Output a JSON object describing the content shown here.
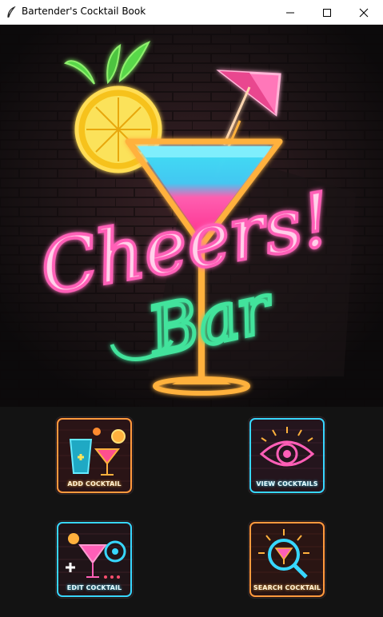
{
  "window": {
    "title": "Bartender's Cocktail Book",
    "app_icon": "feather-icon",
    "controls": {
      "minimize": "minimize-icon",
      "maximize": "maximize-icon",
      "close": "close-icon"
    }
  },
  "hero": {
    "neon_text": "Cheers!",
    "neon_script": "Bar",
    "icon": "neon-cocktail-sign"
  },
  "menu": {
    "add": {
      "label": "ADD COCKTAIL",
      "icon": "cocktail-glasses-icon"
    },
    "view": {
      "label": "VIEW COCKTAILS",
      "icon": "eye-icon"
    },
    "edit": {
      "label": "EDIT COCKTAIL",
      "icon": "cocktail-edit-icon"
    },
    "search": {
      "label": "SEARCH COCKTAIL",
      "icon": "magnifier-icon"
    }
  },
  "colors": {
    "background": "#141414",
    "neon_pink": "#ff5fb7",
    "neon_green": "#43e39c",
    "neon_orange": "#ffb13d",
    "neon_cyan": "#37d7ff"
  }
}
